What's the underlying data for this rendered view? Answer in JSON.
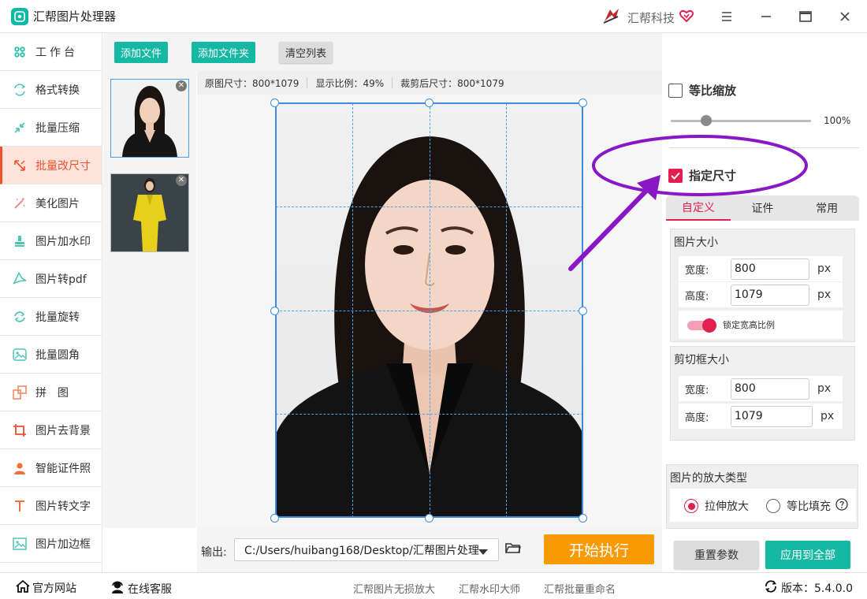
{
  "app": {
    "title": "汇帮图片处理器",
    "brand": "汇帮科技"
  },
  "sidebar": {
    "items": [
      {
        "label": "工作台",
        "icon": "grid-icon"
      },
      {
        "label": "格式转换",
        "icon": "convert-icon"
      },
      {
        "label": "批量压缩",
        "icon": "compress-icon"
      },
      {
        "label": "批量改尺寸",
        "icon": "resize-icon",
        "active": true
      },
      {
        "label": "美化图片",
        "icon": "beautify-icon"
      },
      {
        "label": "图片加水印",
        "icon": "watermark-icon"
      },
      {
        "label": "图片转pdf",
        "icon": "pdf-icon"
      },
      {
        "label": "批量旋转",
        "icon": "rotate-icon"
      },
      {
        "label": "批量圆角",
        "icon": "rounded-corner-icon"
      },
      {
        "label": "拼　图",
        "icon": "collage-icon"
      },
      {
        "label": "图片去背景",
        "icon": "crop-icon"
      },
      {
        "label": "智能证件照",
        "icon": "person-icon"
      },
      {
        "label": "图片转文字",
        "icon": "text-icon"
      },
      {
        "label": "图片加边框",
        "icon": "frame-icon"
      }
    ]
  },
  "toolbar": {
    "add_file": "添加文件",
    "add_folder": "添加文件夹",
    "clear_list": "清空列表"
  },
  "info": {
    "original_size": "原图尺寸：800*1079",
    "display_ratio": "显示比例：49%",
    "cropped_size": "裁剪后尺寸：800*1079"
  },
  "output": {
    "label": "输出:",
    "path": "C:/Users/huibang168/Desktop/汇帮图片处理",
    "run": "开始执行"
  },
  "panel": {
    "proportional_label": "等比缩放",
    "proportional_checked": false,
    "scale_value": "100%",
    "scale_fraction": 0.25,
    "specify_size_label": "指定尺寸",
    "specify_size_checked": true,
    "tabs": [
      "自定义",
      "证件",
      "常用"
    ],
    "image_size": {
      "title": "图片大小",
      "width_label": "宽度:",
      "width": "800",
      "height_label": "高度:",
      "height": "1079",
      "unit": "px",
      "lock_label": "锁定宽高比例"
    },
    "crop_size": {
      "title": "剪切框大小",
      "width_label": "宽度:",
      "width": "800",
      "height_label": "高度:",
      "height": "1079",
      "unit": "px"
    },
    "zoom_type": {
      "title": "图片的放大类型",
      "stretch": "拉伸放大",
      "fill": "等比填充"
    },
    "reset": "重置参数",
    "apply_all": "应用到全部"
  },
  "status": {
    "website": "官方网站",
    "service": "在线客服",
    "link1": "汇帮图片无损放大",
    "link2": "汇帮水印大师",
    "link3": "汇帮批量重命名",
    "version": "版本：5.4.0.0"
  },
  "colors": {
    "accent": "#e2204f",
    "teal": "#14b8a3",
    "orange": "#f79a06",
    "annotation": "#8a17c6"
  }
}
